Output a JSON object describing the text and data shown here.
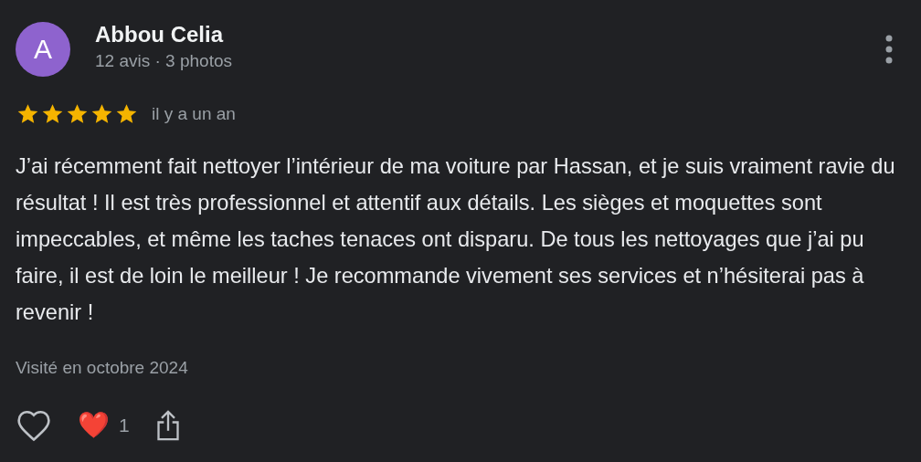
{
  "review": {
    "avatar_letter": "A",
    "name": "Abbou Celia",
    "meta": "12 avis · 3 photos",
    "stars": 5,
    "date": "il y a un an",
    "text": "J’ai récemment fait nettoyer l’intérieur de ma voiture par Hassan, et je suis vraiment ravie du résultat ! Il est très professionnel et attentif aux détails. Les sièges et moquettes sont impeccables, et même les taches tenaces ont disparu. De tous les nettoyages que j’ai pu faire, il est de loin le meilleur ! Je recommande vivement ses services et n’hésiterai pas à revenir !",
    "visited": "Visité en octobre 2024",
    "reaction_emoji": "❤️",
    "reaction_count": "1"
  }
}
